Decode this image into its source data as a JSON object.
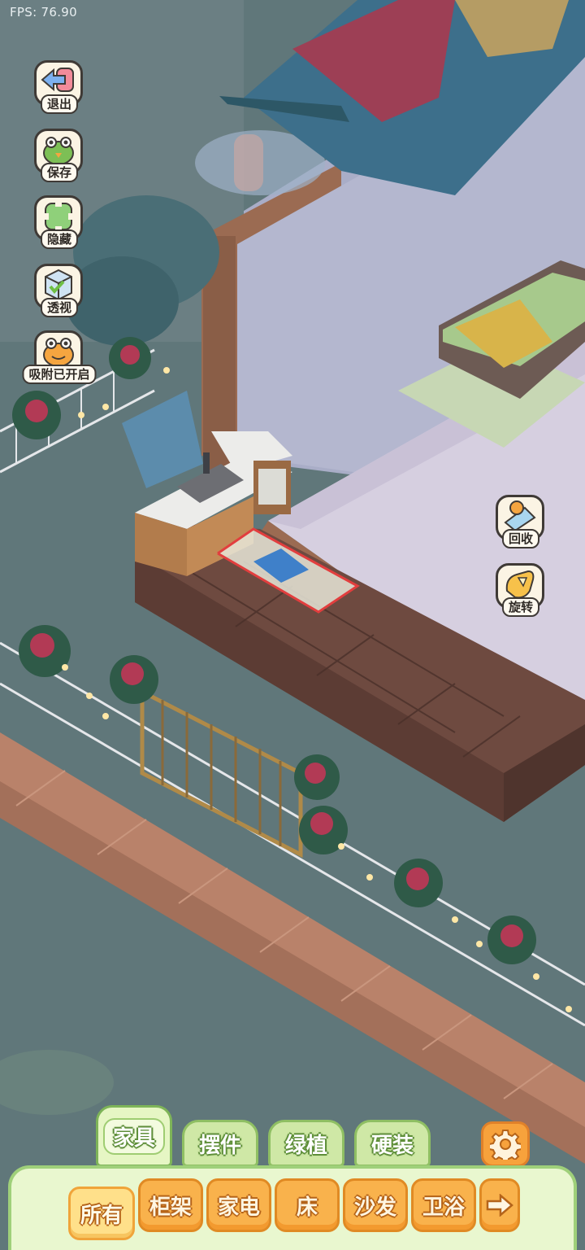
{
  "hud": {
    "fps_text": "FPS: 76.90"
  },
  "left_tools": [
    {
      "label": "退出",
      "icon": "exit-arrow-icon"
    },
    {
      "label": "保存",
      "icon": "save-frog-icon"
    },
    {
      "label": "隐藏",
      "icon": "hide-icon"
    },
    {
      "label": "透视",
      "icon": "perspective-cube-icon"
    },
    {
      "label": "吸附已开启",
      "icon": "snap-frog-icon"
    }
  ],
  "right_tools": [
    {
      "label": "回收",
      "icon": "recycle-dustpan-icon"
    },
    {
      "label": "旋转",
      "icon": "rotate-glove-icon"
    }
  ],
  "tabs": [
    "家具",
    "摆件",
    "绿植",
    "硬装"
  ],
  "active_tab": "家具",
  "categories": [
    "所有",
    "柜架",
    "家电",
    "床",
    "沙发",
    "卫浴"
  ],
  "active_category": "所有",
  "colors": {
    "tab_green": "#cfe8a6",
    "chip_orange": "#f9b24c",
    "panel_bg": "#e9f7cf"
  }
}
